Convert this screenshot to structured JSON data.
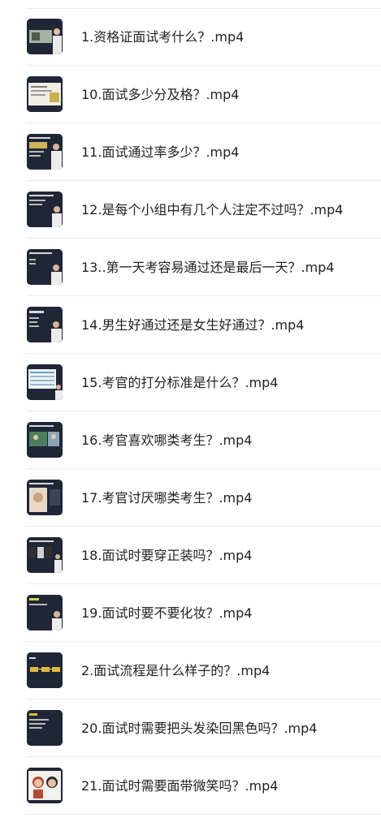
{
  "files": [
    {
      "name": "1.资格证面试考什么？.mp4",
      "thumb": "video-thumbnail"
    },
    {
      "name": "10.面试多少分及格？.mp4",
      "thumb": "video-thumbnail"
    },
    {
      "name": "11.面试通过率多少？.mp4",
      "thumb": "video-thumbnail"
    },
    {
      "name": "12.是每个小组中有几个人注定不过吗？.mp4",
      "thumb": "video-thumbnail"
    },
    {
      "name": "13..第一天考容易通过还是最后一天？.mp4",
      "thumb": "video-thumbnail"
    },
    {
      "name": "14.男生好通过还是女生好通过？.mp4",
      "thumb": "video-thumbnail"
    },
    {
      "name": "15.考官的打分标准是什么？.mp4",
      "thumb": "video-thumbnail"
    },
    {
      "name": "16.考官喜欢哪类考生？.mp4",
      "thumb": "video-thumbnail"
    },
    {
      "name": "17.考官讨厌哪类考生？.mp4",
      "thumb": "video-thumbnail"
    },
    {
      "name": "18.面试时要穿正装吗？.mp4",
      "thumb": "video-thumbnail"
    },
    {
      "name": "19.面试时要不要化妆？.mp4",
      "thumb": "video-thumbnail"
    },
    {
      "name": "2.面试流程是什么样子的？.mp4",
      "thumb": "video-thumbnail"
    },
    {
      "name": "20.面试时需要把头发染回黑色吗？.mp4",
      "thumb": "video-thumbnail"
    },
    {
      "name": "21.面试时需要面带微笑吗？.mp4",
      "thumb": "video-thumbnail"
    }
  ],
  "colors": {
    "text": "#222222",
    "divider": "#eeeeee",
    "thumb_bg": "#1e2433"
  }
}
